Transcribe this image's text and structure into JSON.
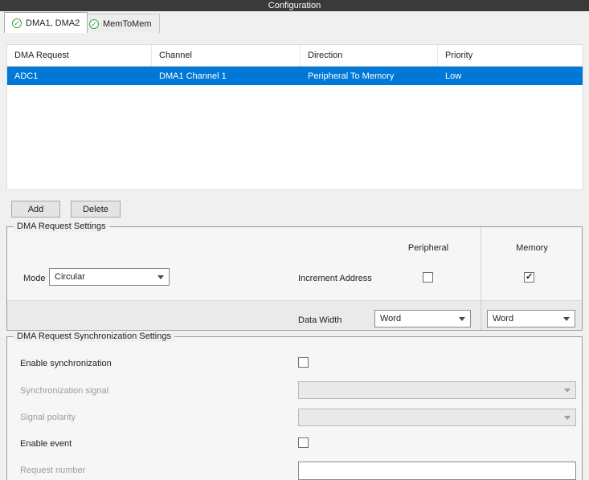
{
  "window": {
    "title": "Configuration"
  },
  "icons": {
    "ok_check": "✓"
  },
  "tabs": [
    {
      "label": "DMA1, DMA2",
      "active": true
    },
    {
      "label": "MemToMem",
      "active": false
    }
  ],
  "table": {
    "columns": [
      "DMA Request",
      "Channel",
      "Direction",
      "Priority"
    ],
    "rows": [
      {
        "dma_request": "ADC1",
        "channel": "DMA1 Channel 1",
        "direction": "Peripheral To Memory",
        "priority": "Low",
        "selected": true
      }
    ]
  },
  "actions": {
    "add": "Add",
    "delete": "Delete"
  },
  "request_settings": {
    "title": "DMA Request Settings",
    "peripheral_header": "Peripheral",
    "memory_header": "Memory",
    "mode_label": "Mode",
    "mode_value": "Circular",
    "increment_address_label": "Increment Address",
    "increment_peripheral_checked": false,
    "increment_peripheral_disabled": true,
    "increment_memory_checked": true,
    "data_width_label": "Data Width",
    "data_width_peripheral": "Word",
    "data_width_memory": "Word"
  },
  "sync_settings": {
    "title": "DMA Request Synchronization Settings",
    "enable_synchronization_label": "Enable synchronization",
    "enable_synchronization_checked": false,
    "synchronization_signal_label": "Synchronization signal",
    "synchronization_signal_value": "",
    "synchronization_signal_disabled": true,
    "signal_polarity_label": "Signal polarity",
    "signal_polarity_value": "",
    "signal_polarity_disabled": true,
    "enable_event_label": "Enable event",
    "enable_event_checked": false,
    "request_number_label": "Request number",
    "request_number_value": ""
  },
  "colors": {
    "selection": "#0078d7",
    "ok_green": "#3aa435",
    "titlebar": "#3a3a3a"
  }
}
